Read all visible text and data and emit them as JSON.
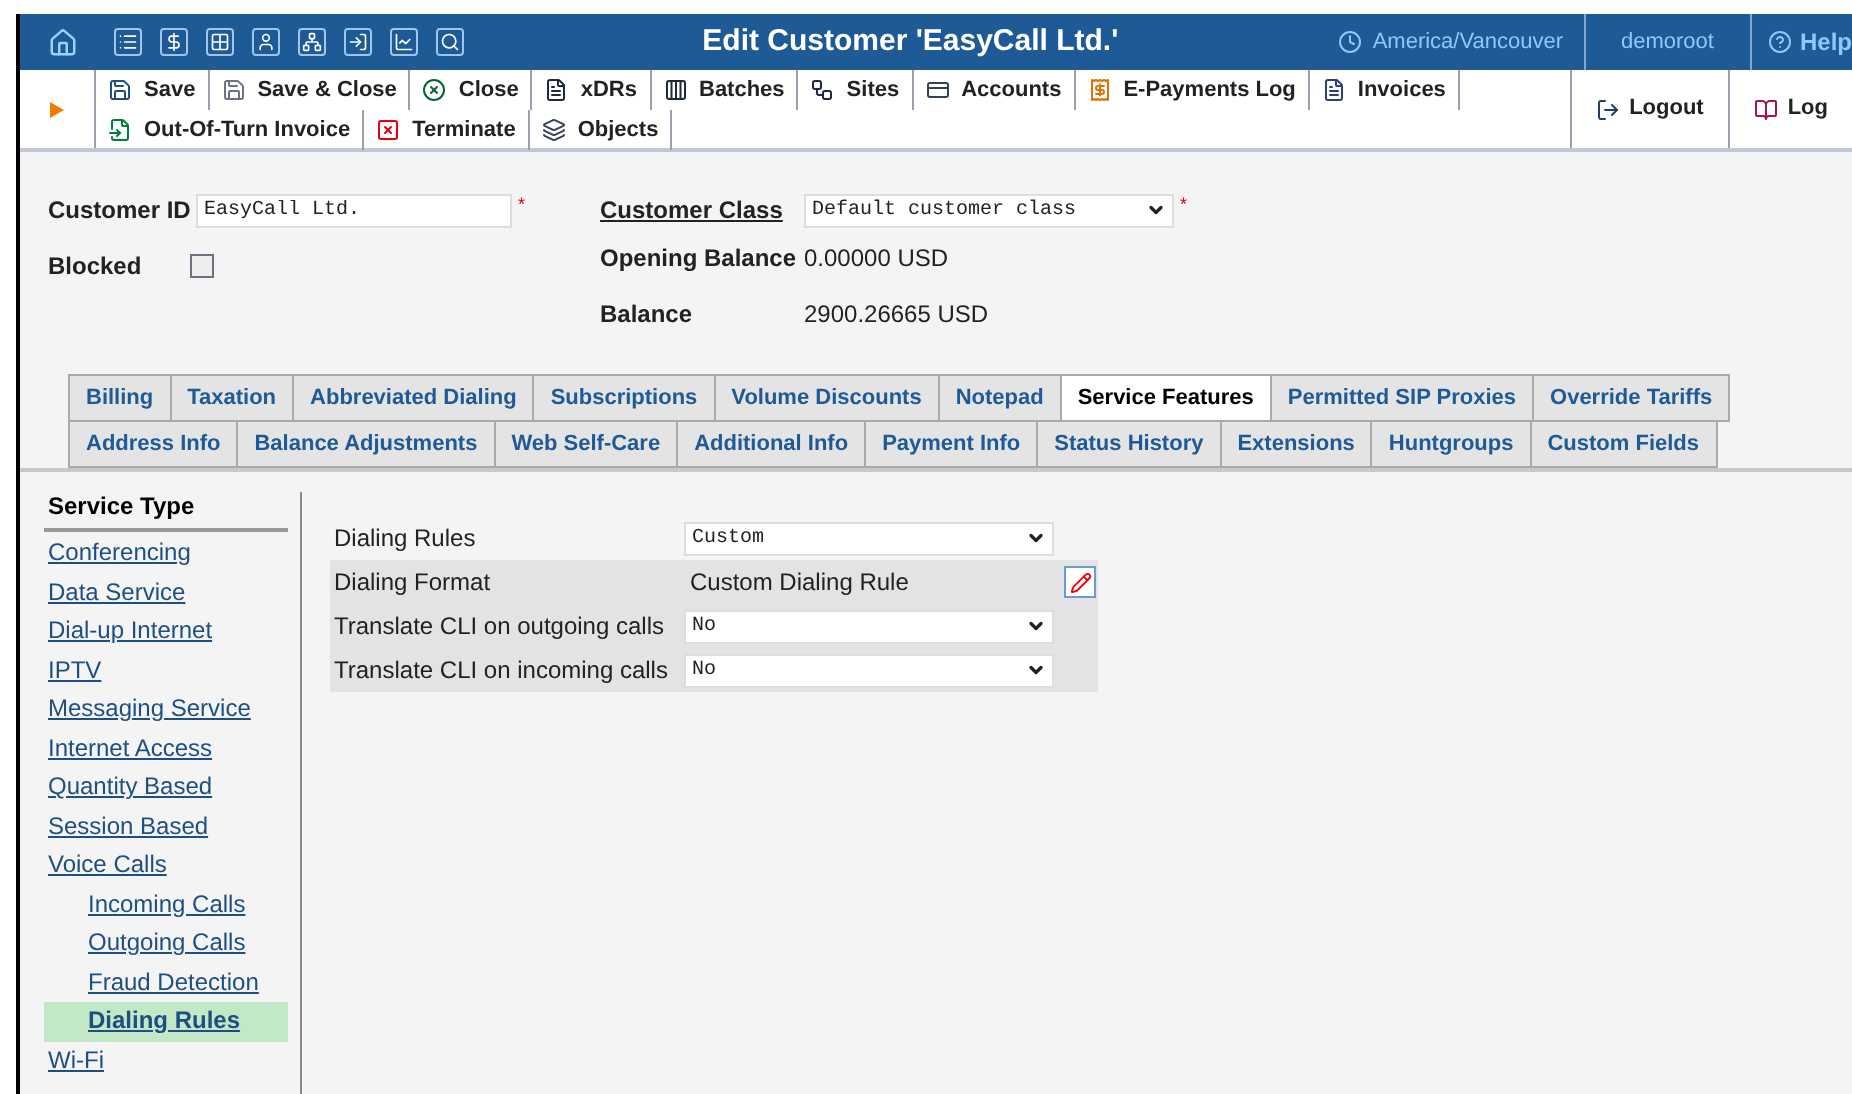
{
  "header": {
    "title": "Edit Customer 'EasyCall Ltd.'",
    "timezone": "America/Vancouver",
    "user": "demoroot",
    "help": "Help"
  },
  "toolbar": {
    "buttons": [
      "Save",
      "Save & Close",
      "Close",
      "xDRs",
      "Batches",
      "Sites",
      "Accounts",
      "E-Payments Log",
      "Invoices",
      "Out-Of-Turn Invoice",
      "Terminate",
      "Objects"
    ],
    "right": [
      "Logout",
      "Log"
    ]
  },
  "customer": {
    "id_label": "Customer ID",
    "id_value": "EasyCall Ltd.",
    "required_mark": "*",
    "blocked_label": "Blocked",
    "blocked": false,
    "class_label": "Customer Class",
    "class_value": "Default customer class",
    "class_required_mark": "*",
    "opening_balance_label": "Opening Balance",
    "opening_balance": "0.00000 USD",
    "balance_label": "Balance",
    "balance": "2900.26665 USD"
  },
  "tabs": [
    [
      {
        "label": "Billing",
        "selected": false
      },
      {
        "label": "Taxation",
        "selected": false
      },
      {
        "label": "Abbreviated Dialing",
        "selected": false
      },
      {
        "label": "Subscriptions",
        "selected": false
      },
      {
        "label": "Volume Discounts",
        "selected": false
      },
      {
        "label": "Notepad",
        "selected": false
      },
      {
        "label": "Service Features",
        "selected": true
      },
      {
        "label": "Permitted SIP Proxies",
        "selected": false
      },
      {
        "label": "Override Tariffs",
        "selected": false
      }
    ],
    [
      {
        "label": "Address Info",
        "selected": false
      },
      {
        "label": "Balance Adjustments",
        "selected": false
      },
      {
        "label": "Web Self-Care",
        "selected": false
      },
      {
        "label": "Additional Info",
        "selected": false
      },
      {
        "label": "Payment Info",
        "selected": false
      },
      {
        "label": "Status History",
        "selected": false
      },
      {
        "label": "Extensions",
        "selected": false
      },
      {
        "label": "Huntgroups",
        "selected": false
      },
      {
        "label": "Custom Fields",
        "selected": false
      }
    ]
  ],
  "sidebar": {
    "heading": "Service Type",
    "items": [
      {
        "label": "Conferencing",
        "selected": false
      },
      {
        "label": "Data Service",
        "selected": false
      },
      {
        "label": "Dial-up Internet",
        "selected": false
      },
      {
        "label": "IPTV",
        "selected": false
      },
      {
        "label": "Messaging Service",
        "selected": false
      },
      {
        "label": "Internet Access",
        "selected": false
      },
      {
        "label": "Quantity Based",
        "selected": false
      },
      {
        "label": "Session Based",
        "selected": false
      },
      {
        "label": "Voice Calls",
        "selected": false,
        "children": [
          {
            "label": "Incoming Calls",
            "selected": false
          },
          {
            "label": "Outgoing Calls",
            "selected": false
          },
          {
            "label": "Fraud Detection",
            "selected": false
          },
          {
            "label": "Dialing Rules",
            "selected": true
          }
        ]
      },
      {
        "label": "Wi-Fi",
        "selected": false
      }
    ]
  },
  "service_form": [
    {
      "kind": "select",
      "label": "Dialing Rules",
      "value": "Custom",
      "shaded": false
    },
    {
      "kind": "text",
      "label": "Dialing Format",
      "value": "Custom Dialing Rule",
      "shaded": true
    },
    {
      "kind": "select",
      "label": "Translate CLI on outgoing calls",
      "value": "No",
      "shaded": true
    },
    {
      "kind": "select",
      "label": "Translate CLI on incoming calls",
      "value": "No",
      "shaded": true
    }
  ]
}
